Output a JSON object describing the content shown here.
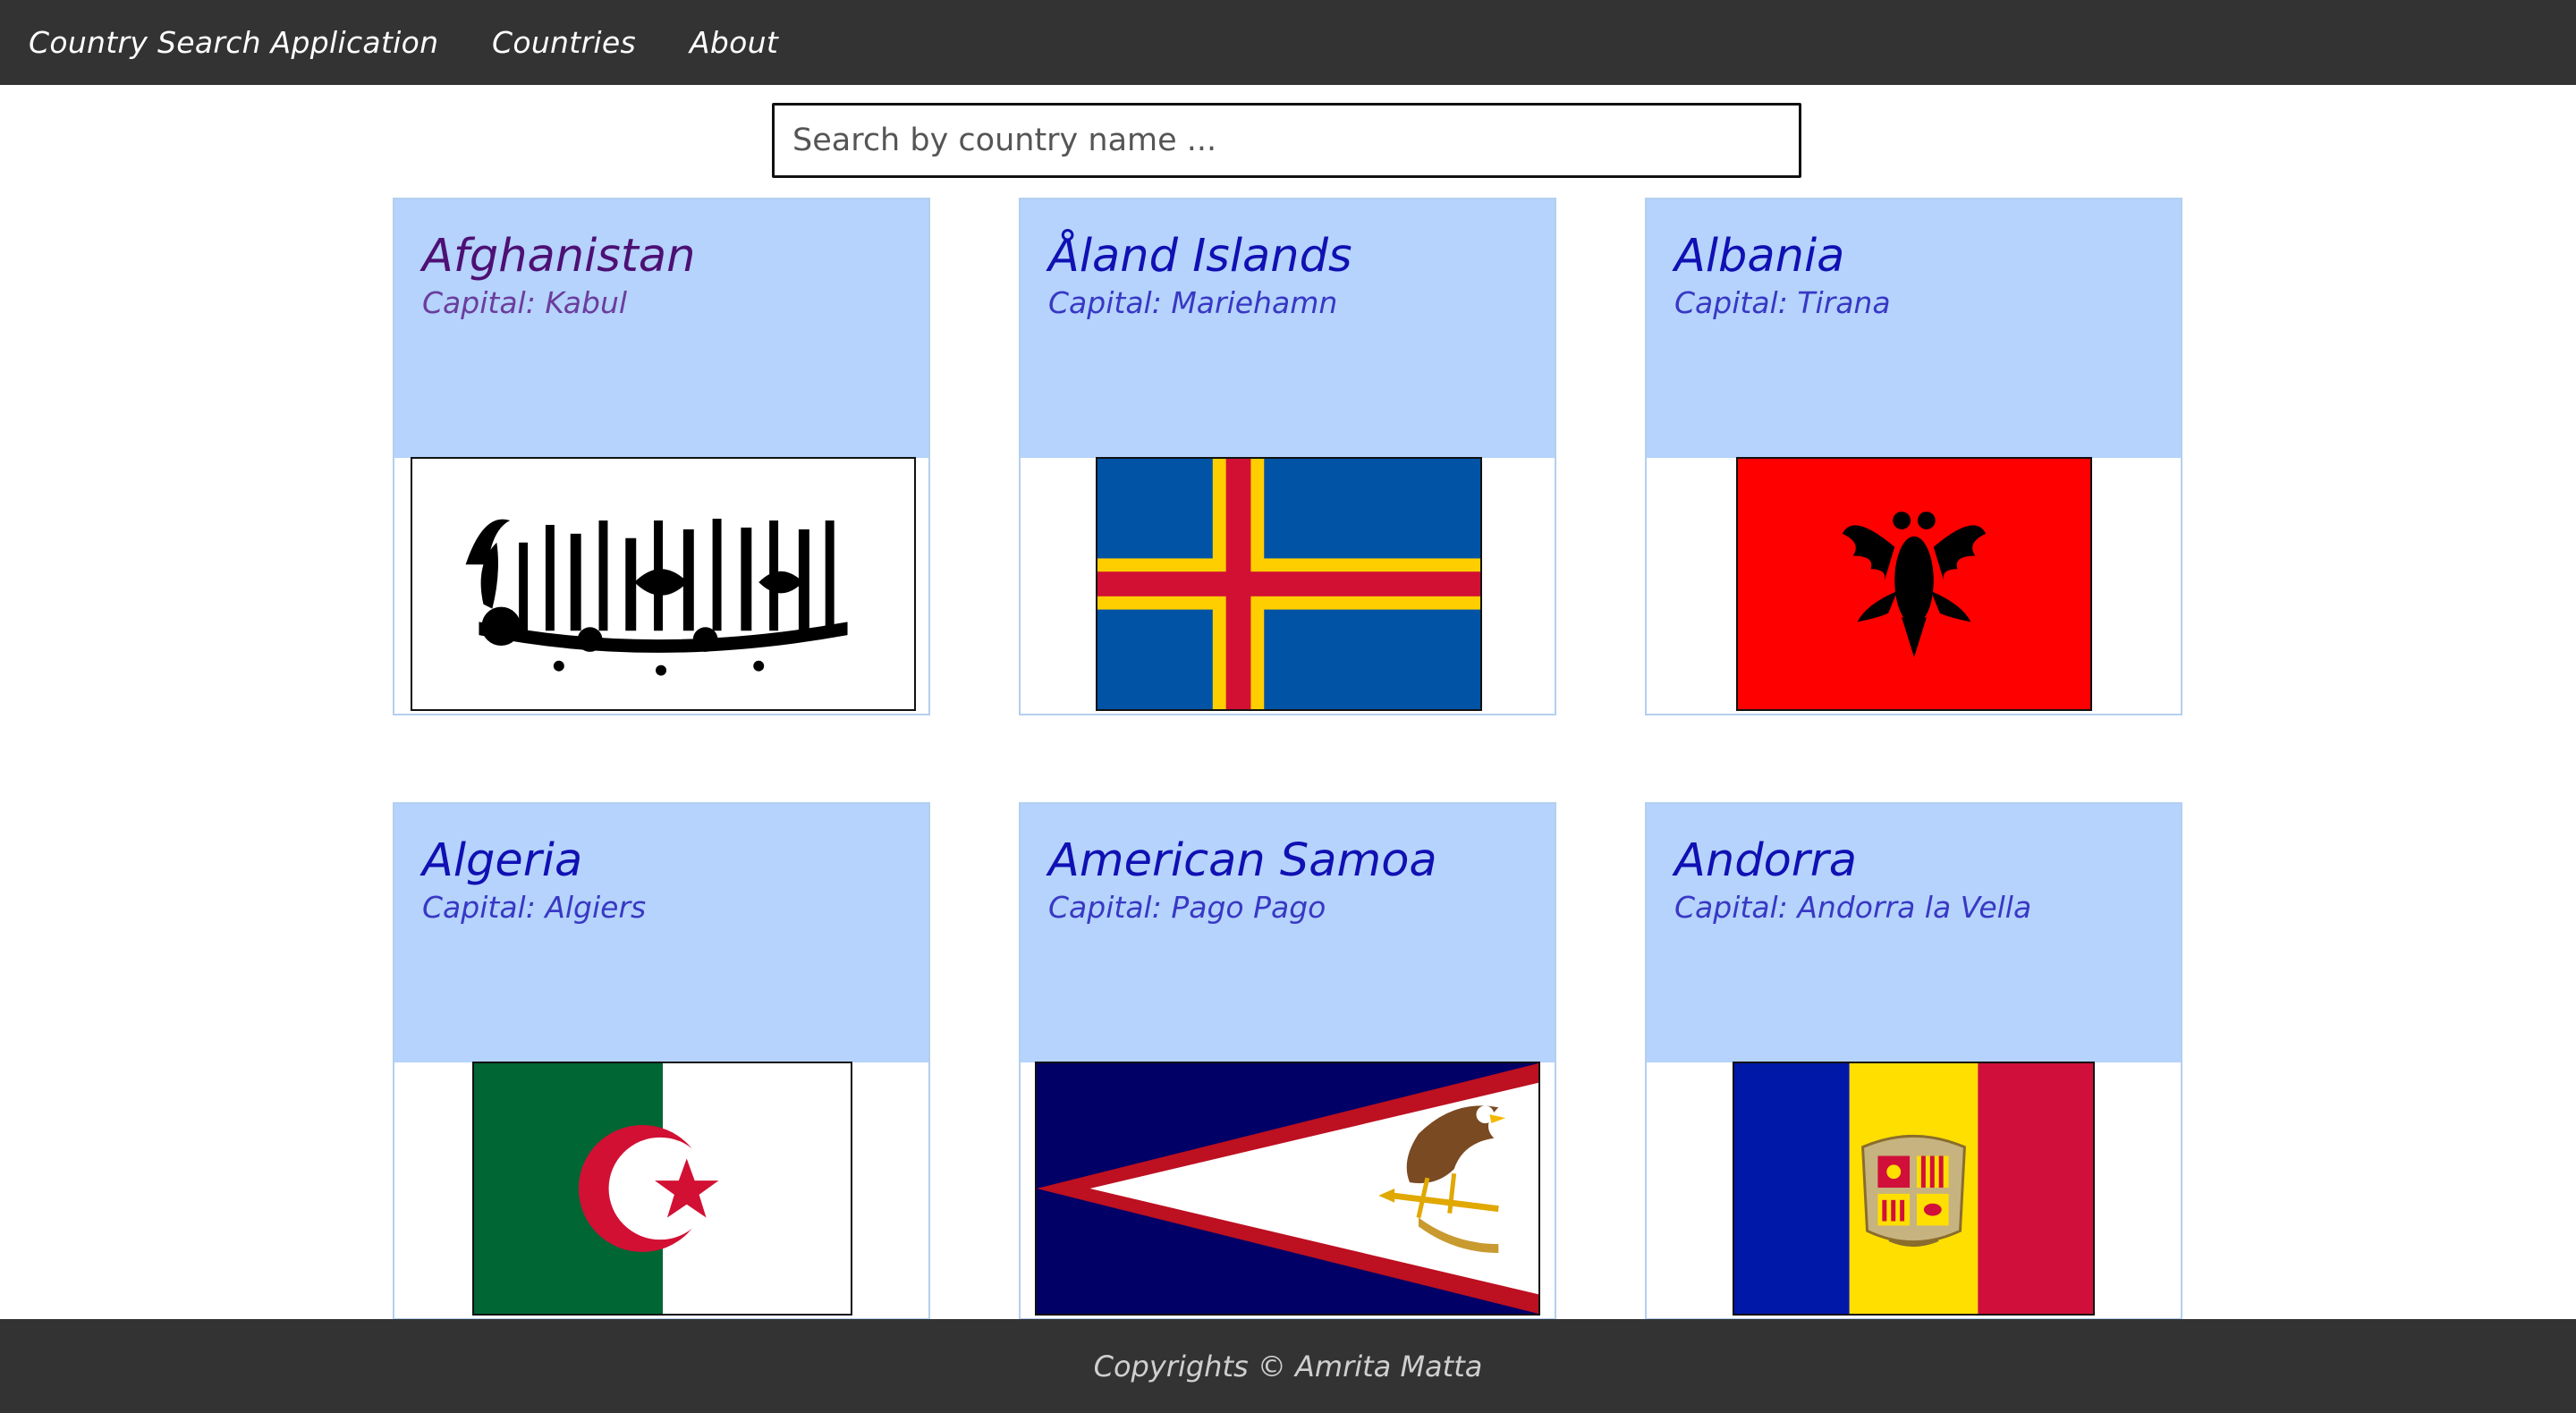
{
  "nav": {
    "brand": "Country Search Application",
    "links": [
      "Countries",
      "About"
    ]
  },
  "search": {
    "placeholder": "Search by country name ...",
    "value": ""
  },
  "countries": [
    {
      "name": "Afghanistan",
      "capital": "Capital: Kabul",
      "flag": "afghanistan-flag"
    },
    {
      "name": "Åland Islands",
      "capital": "Capital: Mariehamn",
      "flag": "aland-islands-flag"
    },
    {
      "name": "Albania",
      "capital": "Capital: Tirana",
      "flag": "albania-flag"
    },
    {
      "name": "Algeria",
      "capital": "Capital: Algiers",
      "flag": "algeria-flag"
    },
    {
      "name": "American Samoa",
      "capital": "Capital: Pago Pago",
      "flag": "american-samoa-flag"
    },
    {
      "name": "Andorra",
      "capital": "Capital: Andorra la Vella",
      "flag": "andorra-flag"
    }
  ],
  "footer": {
    "text": "Copyrights © Amrita Matta"
  },
  "colors": {
    "navbar": "#333333",
    "card_header": "#b5d3fc",
    "card_border": "#b3cff0",
    "link": "#1010b3",
    "visited_link": "#4d1074"
  }
}
